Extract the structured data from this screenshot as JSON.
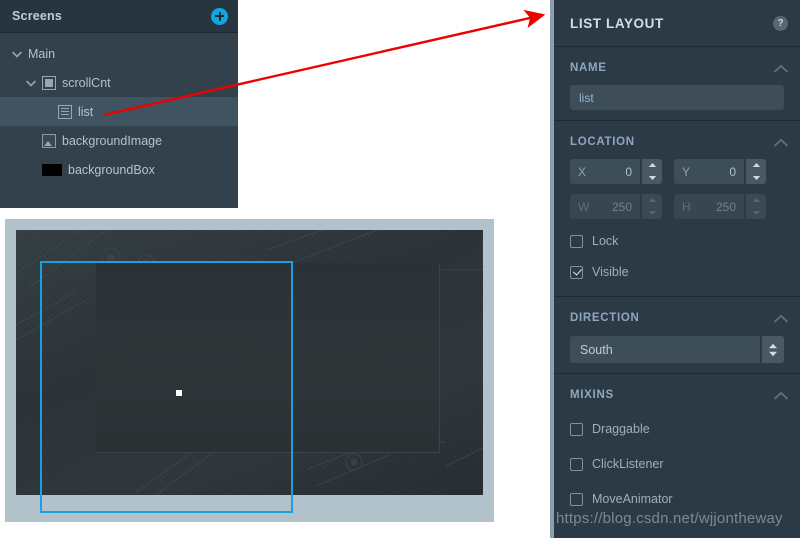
{
  "screens_panel": {
    "title": "Screens",
    "add_icon": "plus-circle-icon",
    "tree": [
      {
        "label": "Main",
        "depth": 0,
        "twisty": "expanded",
        "icon": "none",
        "selected": false
      },
      {
        "label": "scrollCnt",
        "depth": 1,
        "twisty": "expanded",
        "icon": "container",
        "selected": false
      },
      {
        "label": "list",
        "depth": 2,
        "twisty": "none",
        "icon": "list",
        "selected": true
      },
      {
        "label": "backgroundImage",
        "depth": 1,
        "twisty": "none",
        "icon": "image",
        "selected": false
      },
      {
        "label": "backgroundBox",
        "depth": 1,
        "twisty": "none",
        "icon": "box",
        "selected": false
      }
    ]
  },
  "inspector": {
    "title": "LIST LAYOUT",
    "help_icon": "?",
    "sections": {
      "name": {
        "header": "NAME",
        "collapse_icon": "chevron-up-icon",
        "value": "list",
        "placeholder": "list"
      },
      "location": {
        "header": "LOCATION",
        "collapse_icon": "chevron-up-icon",
        "x_label": "X",
        "x_value": "0",
        "y_label": "Y",
        "y_value": "0",
        "w_label": "W",
        "w_value": "250",
        "h_label": "H",
        "h_value": "250",
        "lock_label": "Lock",
        "lock_checked": false,
        "visible_label": "Visible",
        "visible_checked": true
      },
      "direction": {
        "header": "DIRECTION",
        "collapse_icon": "chevron-up-icon",
        "value": "South",
        "options": [
          "South"
        ]
      },
      "mixins": {
        "header": "MIXINS",
        "collapse_icon": "chevron-up-icon",
        "items": [
          {
            "label": "Draggable",
            "checked": false
          },
          {
            "label": "ClickListener",
            "checked": false
          },
          {
            "label": "MoveAnimator",
            "checked": false
          }
        ]
      }
    }
  },
  "canvas": {
    "selection_color": "#1b9fe0",
    "frame_color": "#b1c2cb"
  },
  "annotation": {
    "arrow_color": "#ee0000"
  },
  "watermark": "https://blog.csdn.net/wjjontheway"
}
